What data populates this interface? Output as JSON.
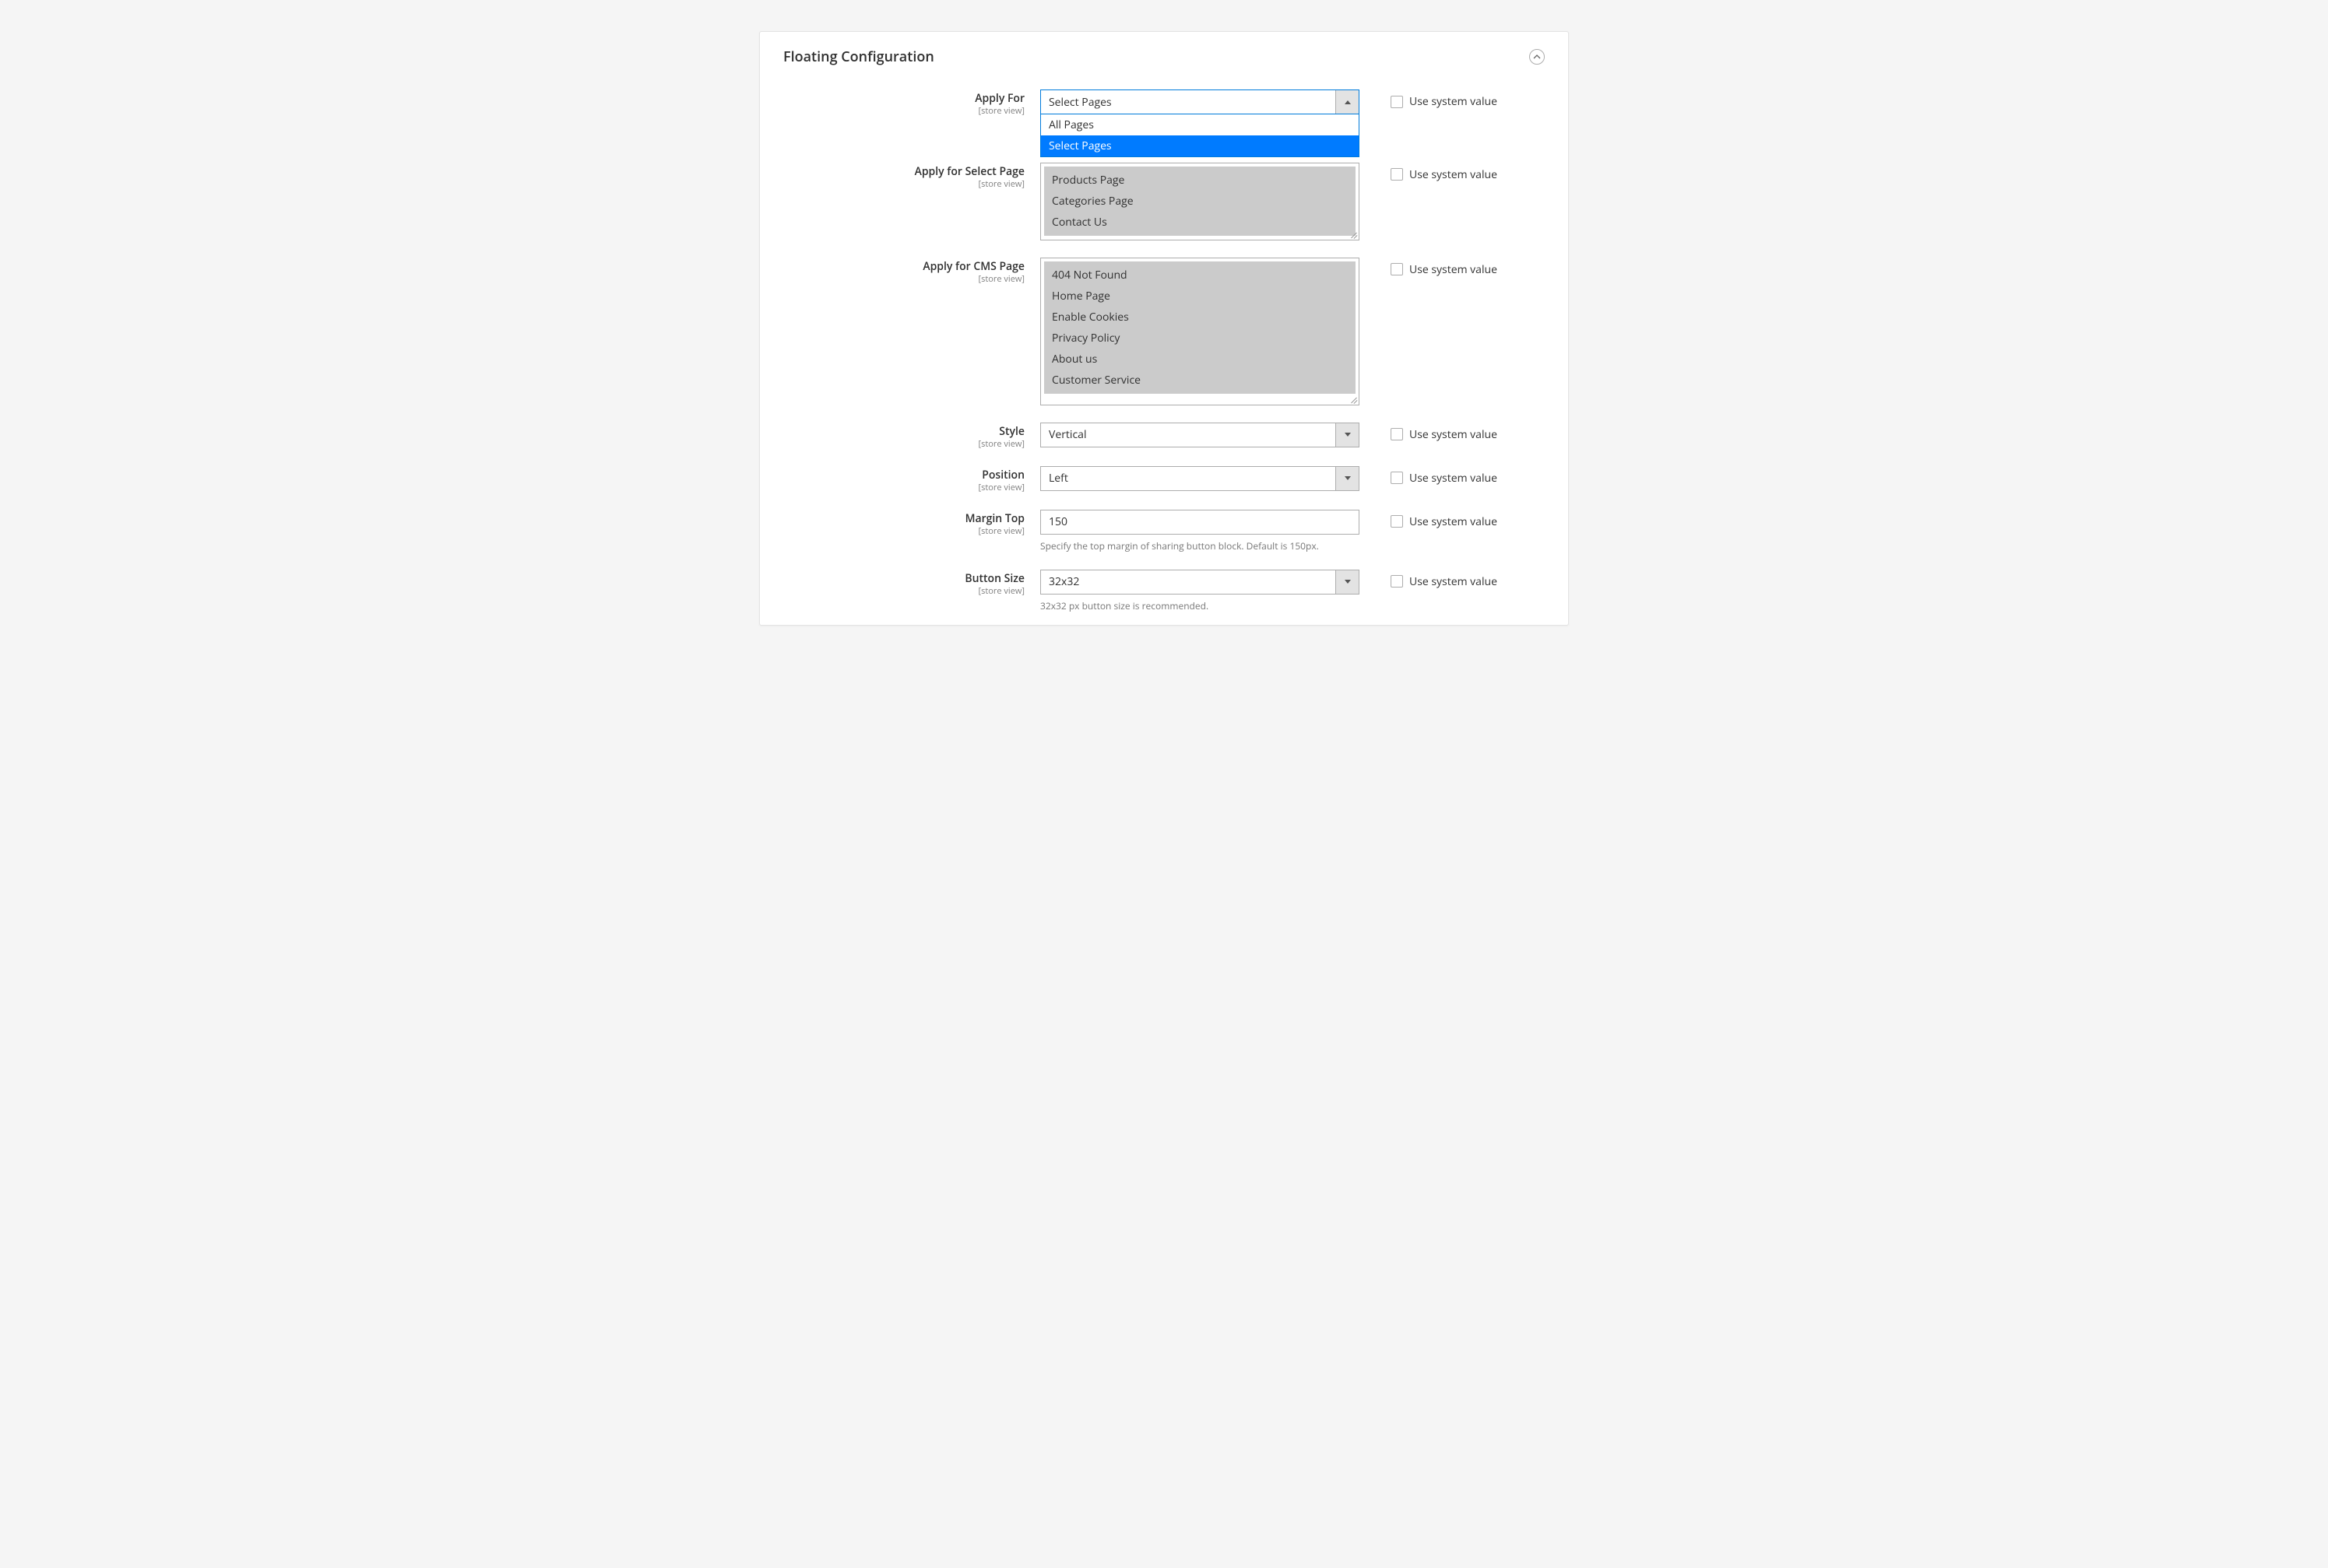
{
  "panel": {
    "title": "Floating Configuration"
  },
  "scope_label": "[store view]",
  "use_system_label": "Use system value",
  "fields": {
    "apply_for": {
      "label": "Apply For",
      "value": "Select Pages",
      "options": [
        "All Pages",
        "Select Pages"
      ],
      "selected_index": 1
    },
    "apply_select_page": {
      "label": "Apply for Select Page",
      "options": [
        "Products Page",
        "Categories Page",
        "Contact Us"
      ]
    },
    "apply_cms_page": {
      "label": "Apply for CMS Page",
      "options": [
        "404 Not Found",
        "Home Page",
        "Enable Cookies",
        "Privacy Policy",
        "About us",
        "Customer Service"
      ]
    },
    "style": {
      "label": "Style",
      "value": "Vertical"
    },
    "position": {
      "label": "Position",
      "value": "Left"
    },
    "margin_top": {
      "label": "Margin Top",
      "value": "150",
      "note": "Specify the top margin of sharing button block. Default is 150px."
    },
    "button_size": {
      "label": "Button Size",
      "value": "32x32",
      "note": "32x32 px button size is recommended."
    }
  }
}
